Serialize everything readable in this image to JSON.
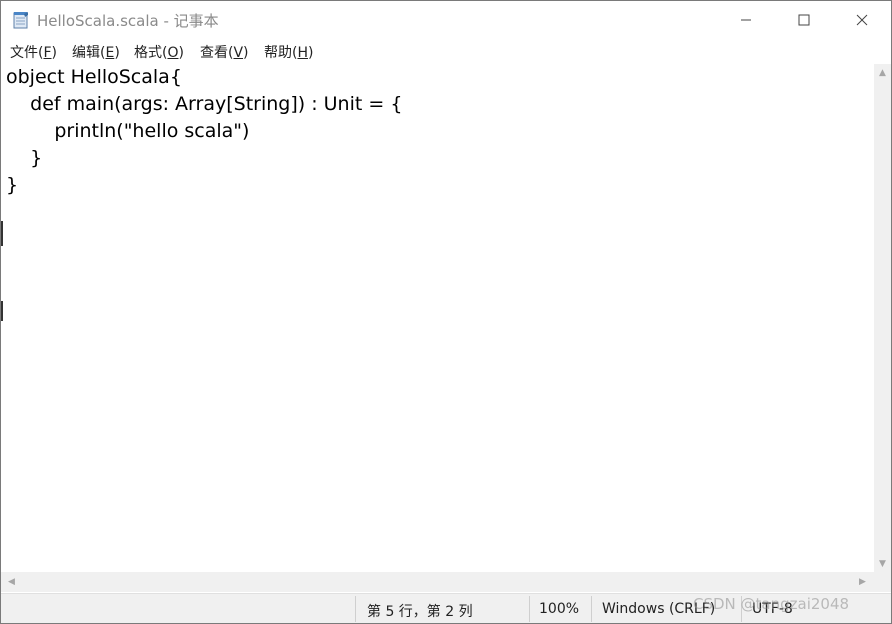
{
  "window": {
    "title": "HelloScala.scala - 记事本"
  },
  "menu": {
    "file": {
      "prefix": "文件(",
      "key": "F",
      "suffix": ")"
    },
    "edit": {
      "prefix": "编辑(",
      "key": "E",
      "suffix": ")"
    },
    "format": {
      "prefix": "格式(",
      "key": "O",
      "suffix": ")"
    },
    "view": {
      "prefix": "查看(",
      "key": "V",
      "suffix": ")"
    },
    "help": {
      "prefix": "帮助(",
      "key": "H",
      "suffix": ")"
    }
  },
  "editor": {
    "lines": [
      "object HelloScala{",
      "    def main(args: Array[String]) : Unit = {",
      "        println(\"hello scala\")",
      "    }",
      "}"
    ]
  },
  "statusbar": {
    "position": "第 5 行，第 2 列",
    "zoom": "100%",
    "line_ending": "Windows (CRLF)",
    "encoding": "UTF-8"
  },
  "watermark": "CSDN @tangzai2048",
  "icons": {
    "app": "notepad-icon",
    "minimize": "minimize-icon",
    "maximize": "maximize-icon",
    "close": "close-icon",
    "scroll_up": "scroll-up-arrow-icon",
    "scroll_down": "scroll-down-arrow-icon",
    "scroll_left": "scroll-left-arrow-icon",
    "scroll_right": "scroll-right-arrow-icon"
  },
  "colors": {
    "title_text": "#8a8a8a",
    "statusbar_bg": "#f0f0f0",
    "scrollbar_bg": "#f0f0f0"
  }
}
